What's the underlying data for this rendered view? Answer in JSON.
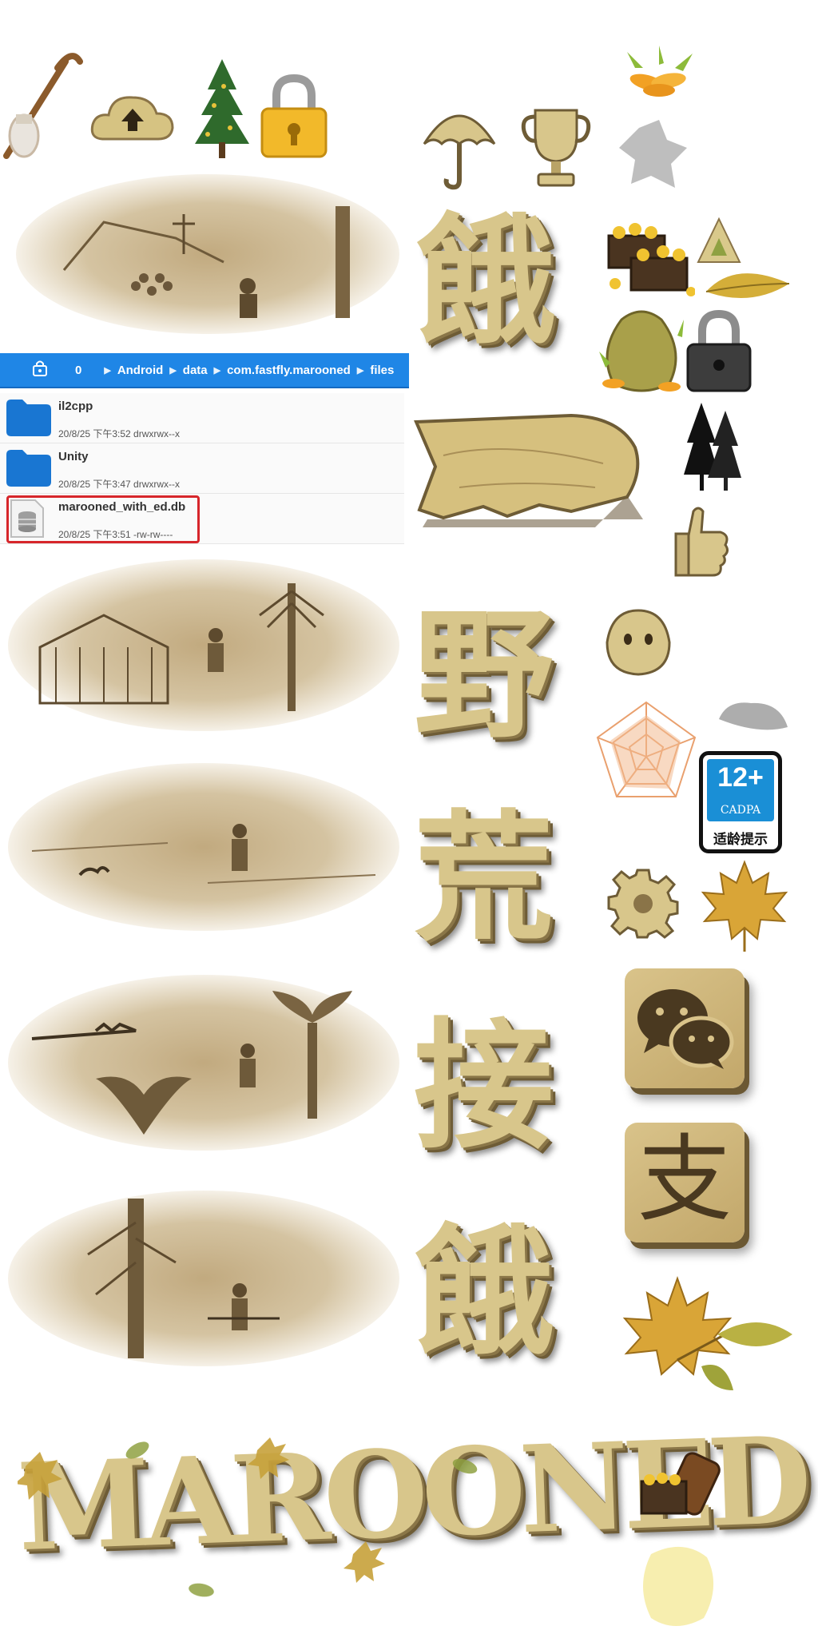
{
  "file_manager": {
    "breadcrumb": [
      "0",
      "Android",
      "data",
      "com.fastfly.marooned",
      "files"
    ],
    "files": [
      {
        "name": "il2cpp",
        "meta": "20/8/25 下午3:52   drwxrwx--x",
        "type": "folder"
      },
      {
        "name": "Unity",
        "meta": "20/8/25 下午3:47   drwxrwx--x",
        "type": "folder"
      },
      {
        "name": "marooned_with_ed.db",
        "meta": "20/8/25 下午3:51   -rw-rw----",
        "type": "database",
        "highlighted": true
      }
    ]
  },
  "stone_glyphs": [
    "餓",
    "野",
    "荒",
    "接",
    "餓"
  ],
  "tile_glyph_alipay": "支",
  "age_rating": {
    "number": "12+",
    "org": "CADPA",
    "caption": "适龄提示"
  },
  "logo_text": "MAROONED",
  "icons": [
    "walking-stick-icon",
    "cloud-upload-icon",
    "pine-tree-icon",
    "padlock-gold-icon",
    "carrots-icon",
    "umbrella-icon",
    "trophy-icon",
    "paw-shadow-icon",
    "treasure-chest-icon",
    "leaf-icon",
    "bag-icon",
    "padlock-dark-icon",
    "trees-silhouette-icon",
    "thumbs-up-icon",
    "emoji-face-icon",
    "radar-chart-icon",
    "cloud-shadow-icon",
    "gear-icon",
    "maple-leaf-icon",
    "wechat-icon",
    "alipay-icon",
    "barrel-icon",
    "paint-smudge-icon"
  ],
  "colors": {
    "accent_blue": "#1f86e6",
    "highlight_red": "#d7262b",
    "stone": "#d8c68b",
    "sepia": "#b59a68"
  }
}
